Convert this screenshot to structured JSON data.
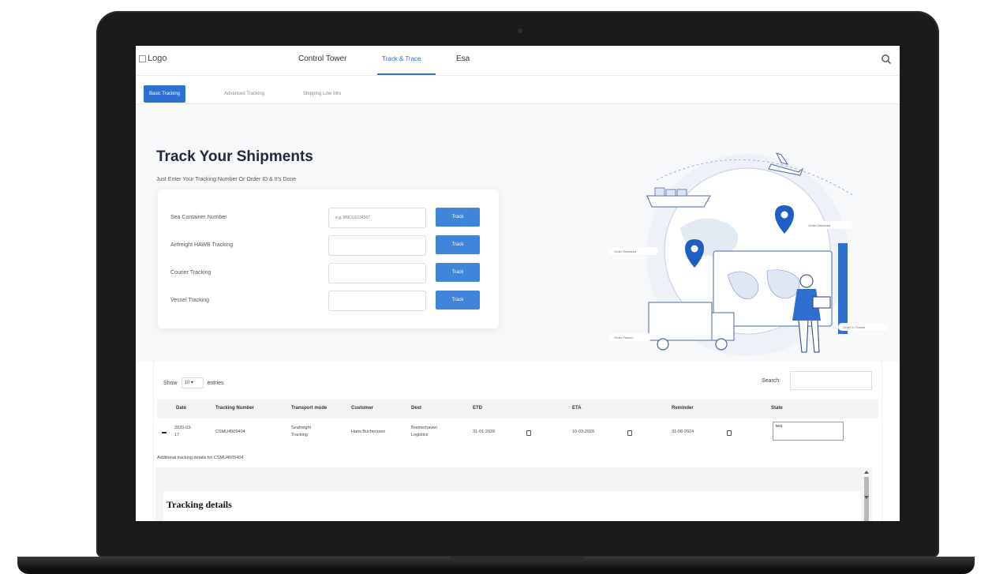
{
  "nav": {
    "logo_alt": "Logo",
    "items": [
      {
        "label": "Control Tower"
      },
      {
        "label": "Track & Trace"
      },
      {
        "label": "Esa"
      }
    ]
  },
  "subtabs": [
    {
      "label": "Basic Tracking"
    },
    {
      "label": "Advanced Tracking"
    },
    {
      "label": "Shipping Line Info"
    }
  ],
  "hero": {
    "title": "Track Your Shipments",
    "subtitle": "Just Enter Your Tracking Number Or Order ID & It's Done"
  },
  "tracking_rows": [
    {
      "label": "Sea Container Number",
      "placeholder": "e.g. MSCU1234567",
      "button": "Track"
    },
    {
      "label": "Airfreight HAWB Tracking",
      "placeholder": "",
      "button": "Track"
    },
    {
      "label": "Courier Tracking",
      "placeholder": "",
      "button": "Track"
    },
    {
      "label": "Vessel Tracking",
      "placeholder": "",
      "button": "Track"
    }
  ],
  "illustration": {
    "labels": [
      "Order Received",
      "Order Delivered",
      "Order Placed",
      "Order In Transit"
    ]
  },
  "table": {
    "show_label": "Show",
    "entries_value": "10",
    "entries_label": "entries",
    "search_label": "Search:",
    "headers": [
      "Date",
      "Tracking Number",
      "Transport mode",
      "Customer",
      "Dest",
      "ETD",
      "ETA",
      "Reminder",
      "State"
    ],
    "rows": [
      {
        "date_1": "2020-03-",
        "date_2": "17",
        "tracking": "CSMU4505404",
        "mode_1": "Seafreight",
        "mode_2": "Tracking",
        "customer": "Hans Bucherssen",
        "dest_1": "Bremerhaven",
        "dest_2": "Logistics",
        "etd": "31-01-2026",
        "eta": "10-03-2026",
        "reminder": "31-08-2024",
        "state": "test"
      }
    ],
    "additional_label": "Additional tracking details for CSMU4505404",
    "details_title": "Tracking details"
  },
  "colors": {
    "accent": "#2f6fd0",
    "button": "#3f86db"
  }
}
